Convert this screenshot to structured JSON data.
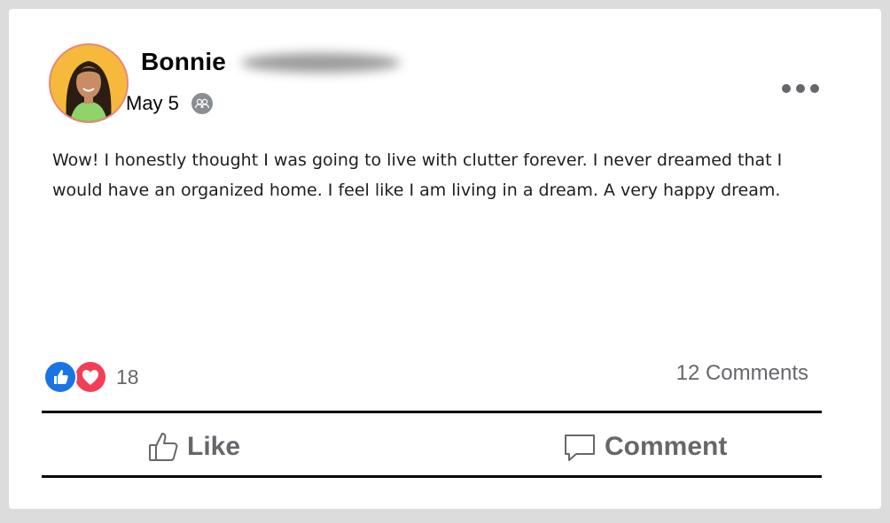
{
  "post": {
    "author_name": "Bonnie",
    "date": "May 5",
    "audience_icon": "friends-icon",
    "text": "Wow! I honestly thought I was going to live with clutter forever. I never dreamed that I would have an organized home. I feel like I am living in a dream. A very happy dream.",
    "more_icon": "more-options-icon"
  },
  "reactions": {
    "types": [
      "like",
      "love"
    ],
    "count": "18",
    "comments_label": "12 Comments"
  },
  "actions": {
    "like_label": "Like",
    "comment_label": "Comment"
  },
  "colors": {
    "like_blue": "#1b74e4",
    "love_red": "#f33e58",
    "muted_text": "#65676b",
    "avatar_bg": "#f6b93b"
  }
}
